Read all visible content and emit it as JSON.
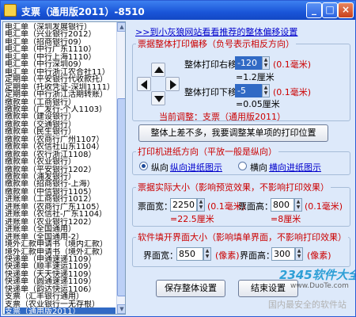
{
  "window": {
    "title": "支票（通用版2011）-8510",
    "min": "_",
    "max": "□",
    "close": "×"
  },
  "list": {
    "items": [
      "电汇单（深圳发展银行）",
      "电汇单（兴业银行2012）",
      "电汇单（招商银行09）",
      "电汇单（中行广东1110）",
      "电汇单（中行上海1110）",
      "电汇单（中行深圳09）",
      "电汇单（中行浙江农合社11）",
      "定期单（平安银行代收款托）",
      "定期单（托收凭证-深圳1111）",
      "定期单（中行浙江活期转账）",
      "缴款单（工商银行）",
      "缴款单（广发行-个人1103）",
      "缴款单（建设银行）",
      "缴款单（交通银行）",
      "缴款单（民生银行）",
      "缴款单（农商行广州1107）",
      "缴款单（农信社山东1104）",
      "缴款单（农行浙江1108）",
      "缴款单（农业银行）",
      "缴款单（平安银行1202）",
      "缴款单（浦发银行）",
      "缴款单（招商银行-上海）",
      "缴款单（中信银行1105）",
      "进账单（工商银行1012）",
      "进账单（农商行广东1105）",
      "进账单（农信社-广东1104）",
      "进账单（农业银行1202）",
      "进账单（全国通用）",
      "进账单（全国通用-2）",
      "境外汇款申请书（境内汇款）",
      "境外汇款申请书（境外汇款）",
      "快递单（申通速递1109）",
      "快递单（顺丰速运1109）",
      "快递单（天天快递1109）",
      "快递单（圆通速递1109）",
      "快递单（韵达快运1106）",
      "支票（汇丰银行通用）",
      "支票（农业银行一无存根）",
      "支票（通用版2011）"
    ],
    "selected_index": 38
  },
  "top_link": ">>到小灰狼网站看看推荐的整体偏移设置",
  "offset_group": {
    "legend": "票据整体打印偏移（负号表示相反方向）",
    "right_label": "整体打印右移：",
    "right_value": "-120",
    "right_unit": "(0.1毫米)",
    "right_mm": "=1.2厘米",
    "down_label": "整体打印下移：",
    "down_value": "-5",
    "down_unit": "(0.1毫米)",
    "down_mm": "=0.05厘米",
    "current_label": "当前调整：支票（通用版2011）"
  },
  "adjust_single_button": "整体上差不多，我要调整某单项的打印位置",
  "direction_group": {
    "legend": "打印机进纸方向（平放一般是纵向）",
    "portrait_label": "纵向",
    "portrait_link": "纵向进纸图示",
    "landscape_label": "横向",
    "landscape_link": "横向进纸图示",
    "selected": "portrait"
  },
  "size_group": {
    "legend": "票据实际大小（影响预览效果，不影响打印效果）",
    "width_label": "票面宽：",
    "width_value": "2250",
    "width_unit": "(0.1毫米)",
    "width_cm": "=22.5厘米",
    "height_label": "票面高：",
    "height_value": "800",
    "height_unit": "(0.1毫米)",
    "height_cm": "=8厘米"
  },
  "ui_group": {
    "legend": "软件填开界面大小（影响填单界面，不影响打印效果）",
    "width_label": "界面宽：",
    "width_value": "850",
    "width_unit": "(像素)",
    "height_label": "界面高：",
    "height_value": "300",
    "height_unit": "(像素)"
  },
  "save_button": "保存整体设置",
  "finish_button": "结束设置",
  "watermark": {
    "brand": "2345软件大全",
    "url": "www.DuoTe.com",
    "slogan": "国内最安全的软件站"
  }
}
